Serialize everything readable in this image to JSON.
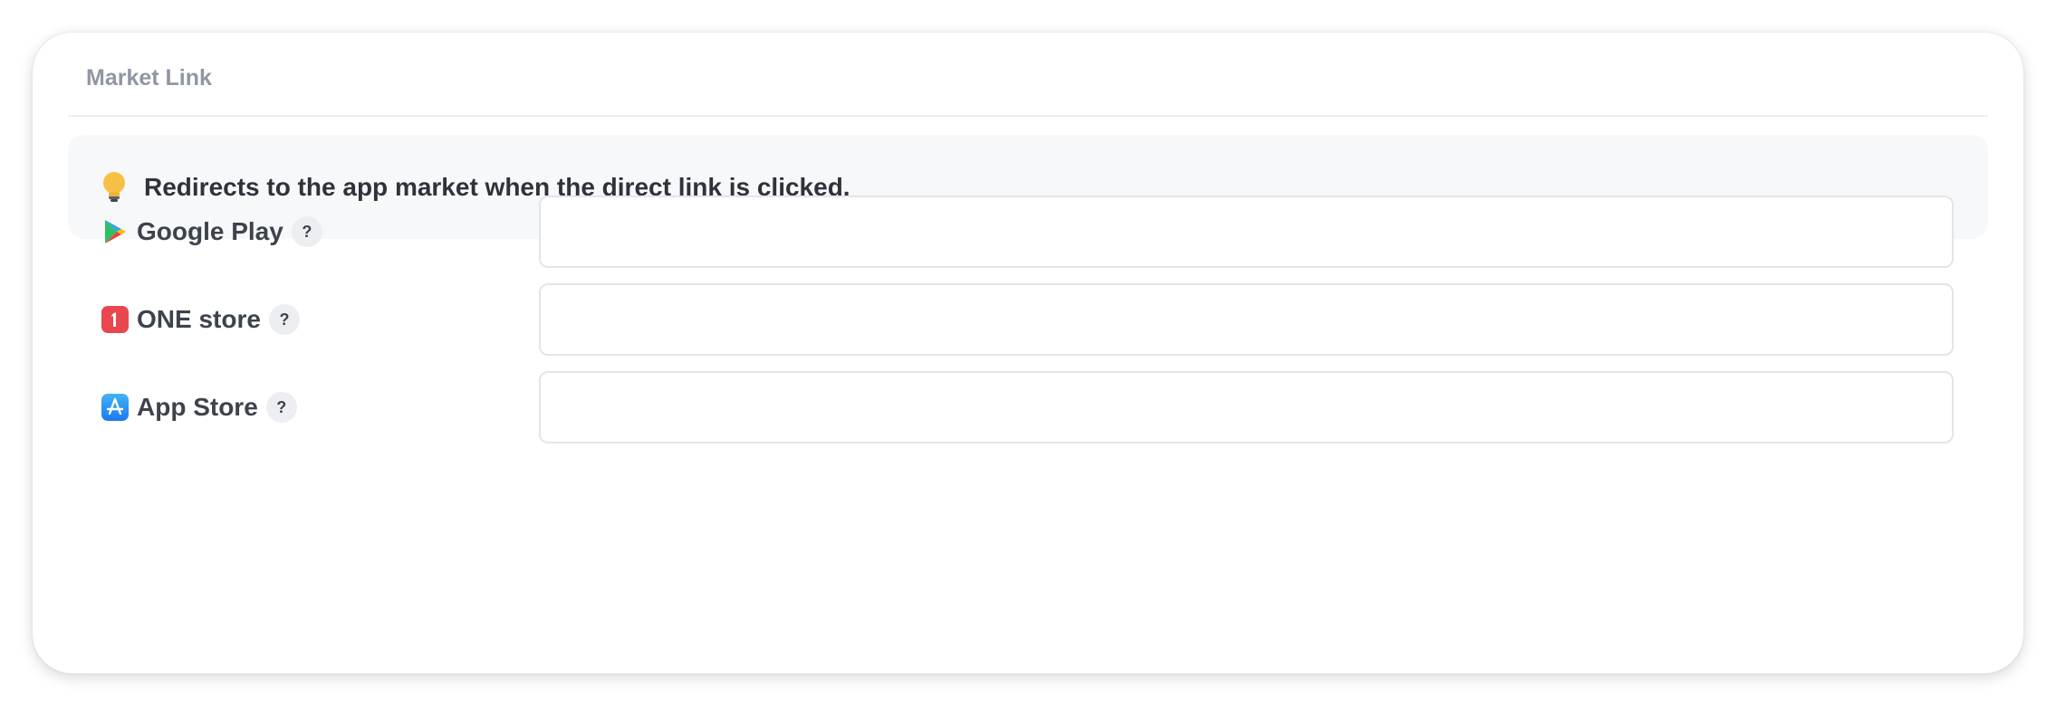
{
  "section": {
    "title": "Market Link"
  },
  "notice": {
    "icon": "lightbulb-icon",
    "text": "Redirects to the app market when the direct link is clicked."
  },
  "markets": [
    {
      "label": "Google Play",
      "icon": "google-play-icon",
      "help": "?",
      "value": "",
      "placeholder": ""
    },
    {
      "label": "ONE store",
      "icon": "one-store-icon",
      "help": "?",
      "value": "",
      "placeholder": ""
    },
    {
      "label": "App Store",
      "icon": "app-store-icon",
      "help": "?",
      "value": "",
      "placeholder": ""
    }
  ],
  "colors": {
    "title": "#8f97a3",
    "label": "#3d434d",
    "notice_bg": "#f7f8fa",
    "one_store": "#e8474f",
    "app_store": "#2a8ff2",
    "bulb": "#f7c044"
  }
}
